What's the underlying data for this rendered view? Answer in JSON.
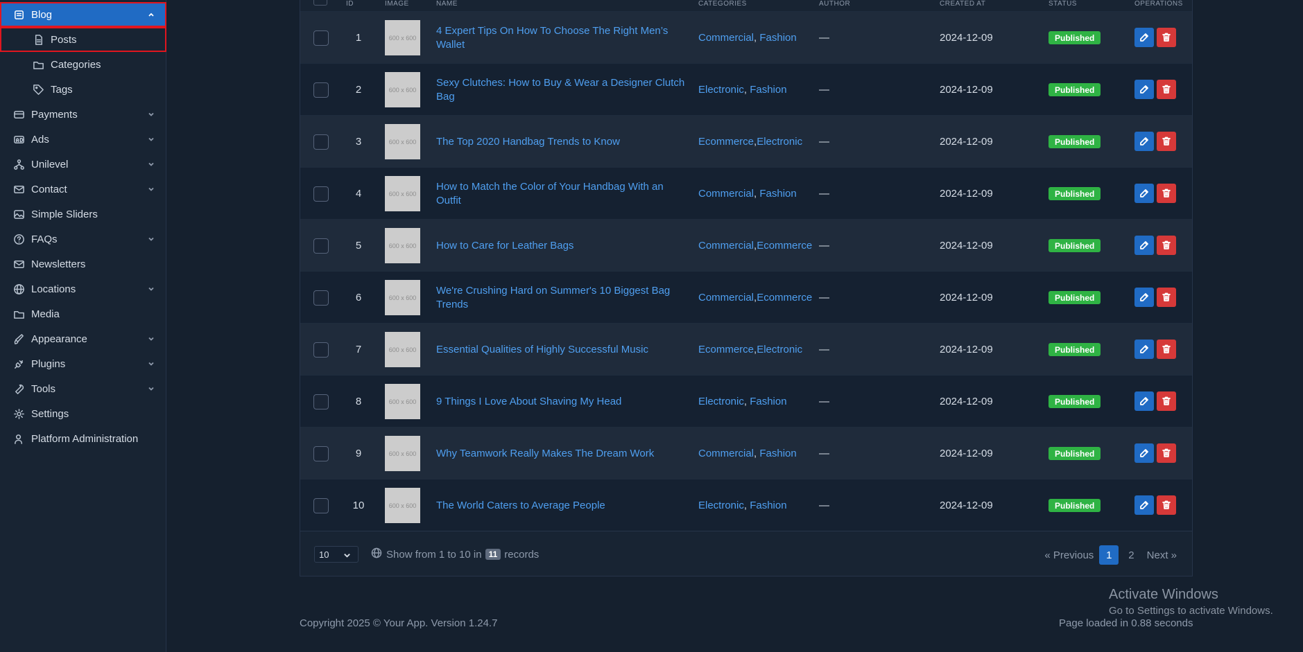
{
  "sidebar": {
    "items": [
      {
        "label": "Blog",
        "icon": "article-icon",
        "chevron": "up"
      },
      {
        "label": "Posts",
        "icon": "file-icon"
      },
      {
        "label": "Categories",
        "icon": "folder-icon"
      },
      {
        "label": "Tags",
        "icon": "tag-icon"
      },
      {
        "label": "Payments",
        "icon": "credit-card-icon",
        "chevron": "down"
      },
      {
        "label": "Ads",
        "icon": "ad-icon",
        "chevron": "down"
      },
      {
        "label": "Unilevel",
        "icon": "hierarchy-icon",
        "chevron": "down"
      },
      {
        "label": "Contact",
        "icon": "mail-icon",
        "chevron": "down"
      },
      {
        "label": "Simple Sliders",
        "icon": "image-icon"
      },
      {
        "label": "FAQs",
        "icon": "help-circle-icon",
        "chevron": "down"
      },
      {
        "label": "Newsletters",
        "icon": "mail-icon"
      },
      {
        "label": "Locations",
        "icon": "globe-icon",
        "chevron": "down"
      },
      {
        "label": "Media",
        "icon": "folder-icon"
      },
      {
        "label": "Appearance",
        "icon": "brush-icon",
        "chevron": "down"
      },
      {
        "label": "Plugins",
        "icon": "plug-icon",
        "chevron": "down"
      },
      {
        "label": "Tools",
        "icon": "tool-icon",
        "chevron": "down"
      },
      {
        "label": "Settings",
        "icon": "gear-icon"
      },
      {
        "label": "Platform Administration",
        "icon": "user-cog-icon"
      }
    ]
  },
  "table": {
    "headers": {
      "id": "ID",
      "image": "IMAGE",
      "name": "NAME",
      "categories": "CATEGORIES",
      "author": "AUTHOR",
      "created_at": "CREATED AT",
      "status": "STATUS",
      "operations": "OPERATIONS"
    },
    "thumb_label": "600 x 600",
    "rows": [
      {
        "id": "1",
        "name": "4 Expert Tips On How To Choose The Right Men’s Wallet",
        "cat1": "Commercial",
        "sep": ", ",
        "cat2": "Fashion",
        "author": "—",
        "date": "2024-12-09",
        "status": "Published"
      },
      {
        "id": "2",
        "name": "Sexy Clutches: How to Buy & Wear a Designer Clutch Bag",
        "cat1": "Electronic",
        "sep": ", ",
        "cat2": "Fashion",
        "author": "—",
        "date": "2024-12-09",
        "status": "Published"
      },
      {
        "id": "3",
        "name": "The Top 2020 Handbag Trends to Know",
        "cat1": "Ecommerce",
        "sep": ",",
        "cat2": "Electronic",
        "author": "—",
        "date": "2024-12-09",
        "status": "Published"
      },
      {
        "id": "4",
        "name": "How to Match the Color of Your Handbag With an Outfit",
        "cat1": "Commercial",
        "sep": ", ",
        "cat2": "Fashion",
        "author": "—",
        "date": "2024-12-09",
        "status": "Published"
      },
      {
        "id": "5",
        "name": "How to Care for Leather Bags",
        "cat1": "Commercial",
        "sep": ",",
        "cat2": "Ecommerce",
        "author": "—",
        "date": "2024-12-09",
        "status": "Published"
      },
      {
        "id": "6",
        "name": "We're Crushing Hard on Summer's 10 Biggest Bag Trends",
        "cat1": "Commercial",
        "sep": ",",
        "cat2": "Ecommerce",
        "author": "—",
        "date": "2024-12-09",
        "status": "Published"
      },
      {
        "id": "7",
        "name": "Essential Qualities of Highly Successful Music",
        "cat1": "Ecommerce",
        "sep": ",",
        "cat2": "Electronic",
        "author": "—",
        "date": "2024-12-09",
        "status": "Published"
      },
      {
        "id": "8",
        "name": "9 Things I Love About Shaving My Head",
        "cat1": "Electronic",
        "sep": ", ",
        "cat2": "Fashion",
        "author": "—",
        "date": "2024-12-09",
        "status": "Published"
      },
      {
        "id": "9",
        "name": "Why Teamwork Really Makes The Dream Work",
        "cat1": "Commercial",
        "sep": ", ",
        "cat2": "Fashion",
        "author": "—",
        "date": "2024-12-09",
        "status": "Published"
      },
      {
        "id": "10",
        "name": "The World Caters to Average People",
        "cat1": "Electronic",
        "sep": ", ",
        "cat2": "Fashion",
        "author": "—",
        "date": "2024-12-09",
        "status": "Published"
      }
    ]
  },
  "footer": {
    "per_page": "10",
    "records_prefix": "Show from 1 to 10 in",
    "records_count": "11",
    "records_suffix": "records",
    "prev": "« Previous",
    "page1": "1",
    "page2": "2",
    "next": "Next »"
  },
  "page_footer": {
    "copyright": "Copyright 2025 © Your App. Version 1.24.7",
    "loaded": "Page loaded in 0.88 seconds"
  },
  "windows": {
    "title": "Activate Windows",
    "sub": "Go to Settings to activate Windows."
  },
  "colors": {
    "accent": "#206bc4",
    "success": "#2fb344",
    "danger": "#d63939",
    "highlight": "#e0161f"
  }
}
